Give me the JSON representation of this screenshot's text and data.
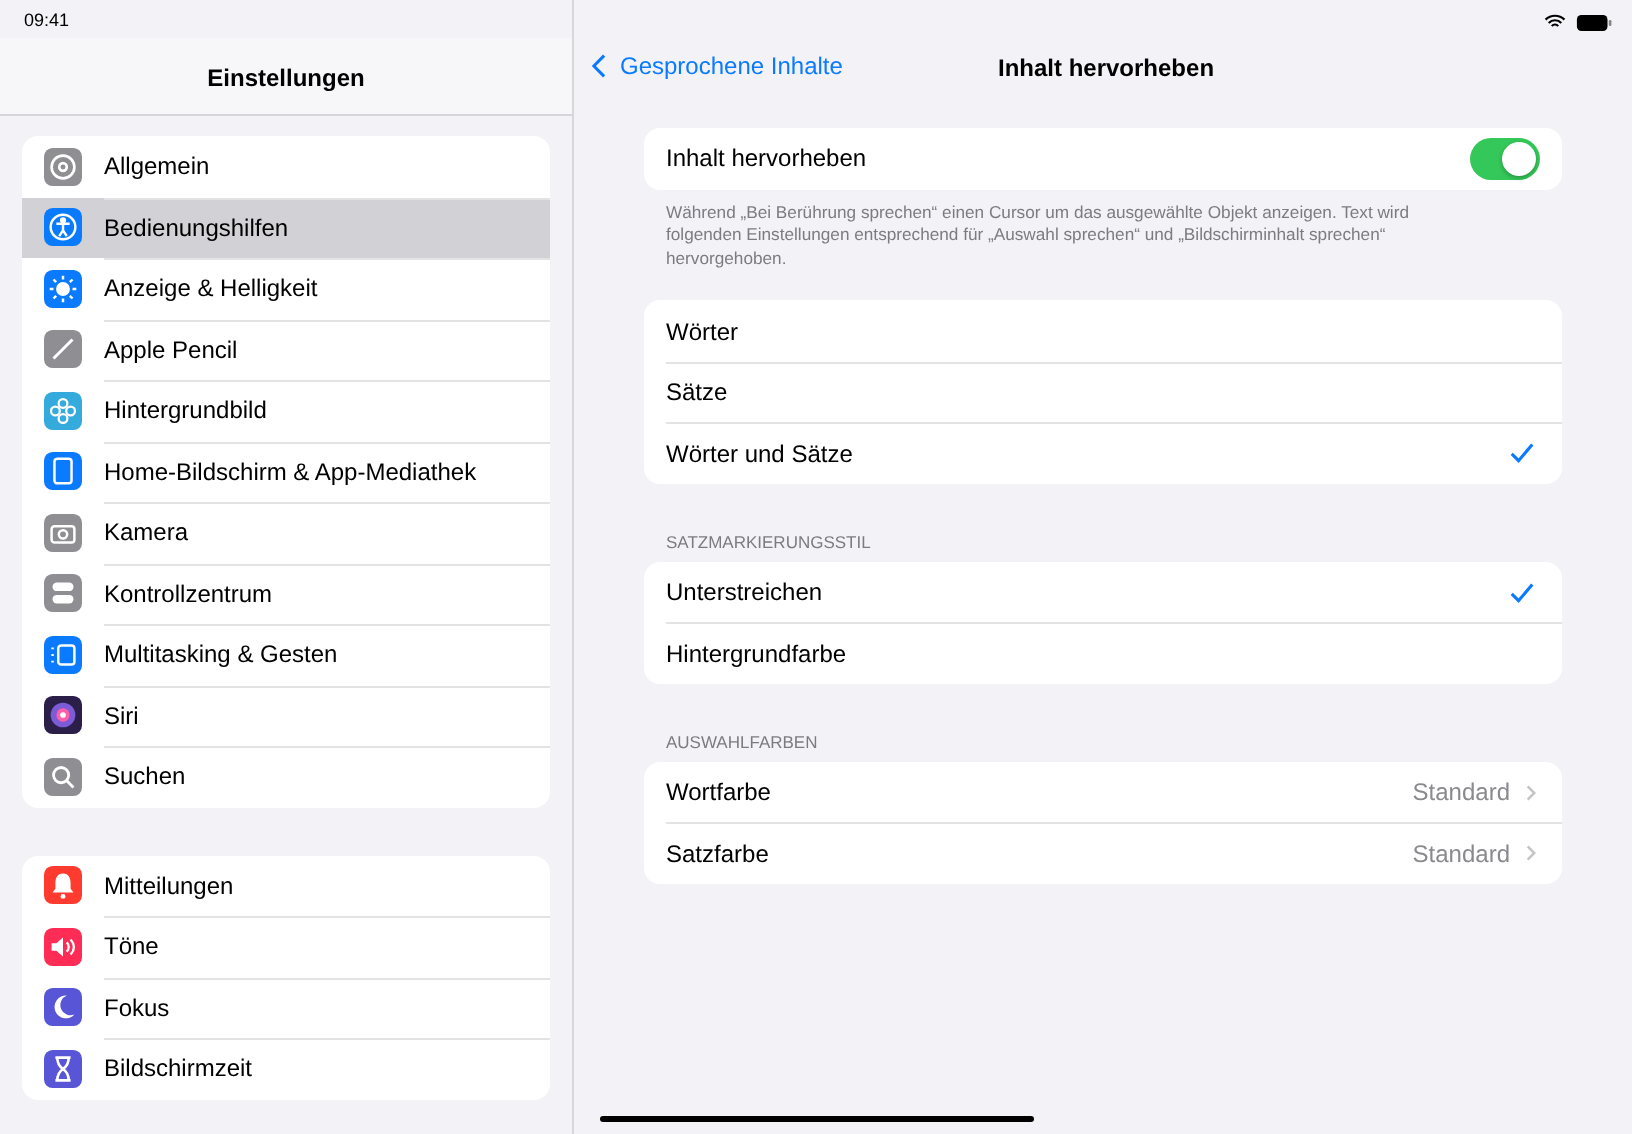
{
  "status_bar": {
    "time": "09:41"
  },
  "sidebar": {
    "title": "Einstellungen",
    "groups": [
      {
        "items": [
          {
            "label": "Allgemein",
            "kind": "gear",
            "color": "#8e8e93",
            "selected": false
          },
          {
            "label": "Bedienungshilfen",
            "kind": "accessibility",
            "color": "#0a7aff",
            "selected": true
          },
          {
            "label": "Anzeige & Helligkeit",
            "kind": "sun",
            "color": "#0a7aff",
            "selected": false
          },
          {
            "label": "Apple Pencil",
            "kind": "pencil",
            "color": "#8e8e93",
            "selected": false
          },
          {
            "label": "Hintergrundbild",
            "kind": "flower",
            "color": "#35aadc",
            "selected": false
          },
          {
            "label": "Home-Bildschirm & App-Mediathek",
            "kind": "tablet",
            "color": "#0a7aff",
            "selected": false
          },
          {
            "label": "Kamera",
            "kind": "camera",
            "color": "#8e8e93",
            "selected": false
          },
          {
            "label": "Kontrollzentrum",
            "kind": "switches",
            "color": "#8e8e93",
            "selected": false
          },
          {
            "label": "Multitasking & Gesten",
            "kind": "multitask",
            "color": "#0a7aff",
            "selected": false
          },
          {
            "label": "Siri",
            "kind": "orb",
            "color": "#2b1f4a",
            "selected": false
          },
          {
            "label": "Suchen",
            "kind": "search",
            "color": "#8e8e93",
            "selected": false
          }
        ]
      },
      {
        "items": [
          {
            "label": "Mitteilungen",
            "kind": "bell",
            "color": "#ff3b30",
            "selected": false
          },
          {
            "label": "Töne",
            "kind": "speaker",
            "color": "#ff2d55",
            "selected": false
          },
          {
            "label": "Fokus",
            "kind": "moon",
            "color": "#5856d6",
            "selected": false
          },
          {
            "label": "Bildschirmzeit",
            "kind": "hourglass",
            "color": "#5856d6",
            "selected": false
          }
        ]
      }
    ]
  },
  "nav": {
    "back": "Gesprochene Inhalte",
    "title": "Inhalt hervorheben"
  },
  "toggle": {
    "label": "Inhalt hervorheben",
    "on": true,
    "footer": "Während „Bei Berührung sprechen“ einen Cursor um das ausgewählte Objekt anzeigen. Text wird folgenden Einstellungen entsprechend für „Auswahl sprechen“ und „Bildschirminhalt sprechen“ hervorgehoben."
  },
  "highlight_options": [
    {
      "label": "Wörter",
      "selected": false
    },
    {
      "label": "Sätze",
      "selected": false
    },
    {
      "label": "Wörter und Sätze",
      "selected": true
    }
  ],
  "sentence_style": {
    "header": "SATZMARKIERUNGSSTIL",
    "options": [
      {
        "label": "Unterstreichen",
        "selected": true
      },
      {
        "label": "Hintergrundfarbe",
        "selected": false
      }
    ]
  },
  "selection_colors": {
    "header": "AUSWAHLFARBEN",
    "rows": [
      {
        "label": "Wortfarbe",
        "value": "Standard"
      },
      {
        "label": "Satzfarbe",
        "value": "Standard"
      }
    ]
  }
}
